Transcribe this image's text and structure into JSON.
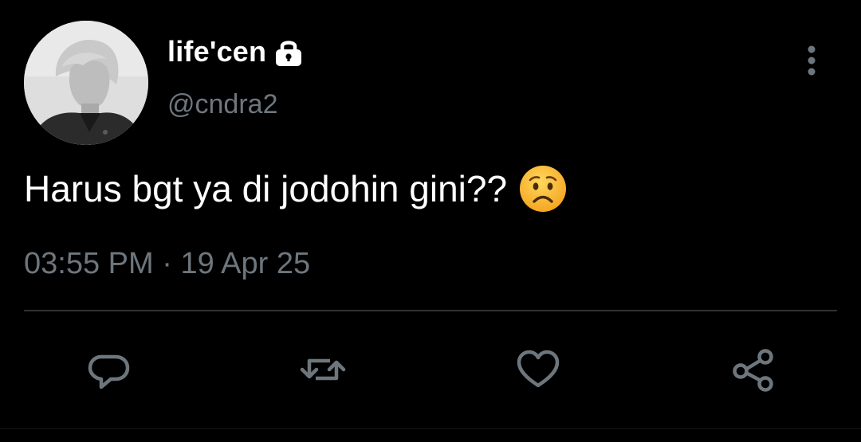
{
  "author": {
    "display_name": "life'cen",
    "handle": "@cndra2",
    "protected": true,
    "avatar": "profile-photo-grayscale"
  },
  "tweet": {
    "text": "Harus bgt ya di jodohin gini??",
    "emoji": "worried-face-emoji",
    "time": "03:55 PM",
    "separator": "·",
    "date": "19 Apr 25"
  },
  "actions": [
    {
      "name": "reply",
      "icon": "comment-icon"
    },
    {
      "name": "retweet",
      "icon": "retweet-icon"
    },
    {
      "name": "like",
      "icon": "heart-icon"
    },
    {
      "name": "share",
      "icon": "share-icon"
    }
  ],
  "colors": {
    "background": "#000000",
    "primary_text": "#ffffff",
    "secondary_text": "#6e767d",
    "divider": "#2f3336",
    "icon": "#6e767d"
  }
}
